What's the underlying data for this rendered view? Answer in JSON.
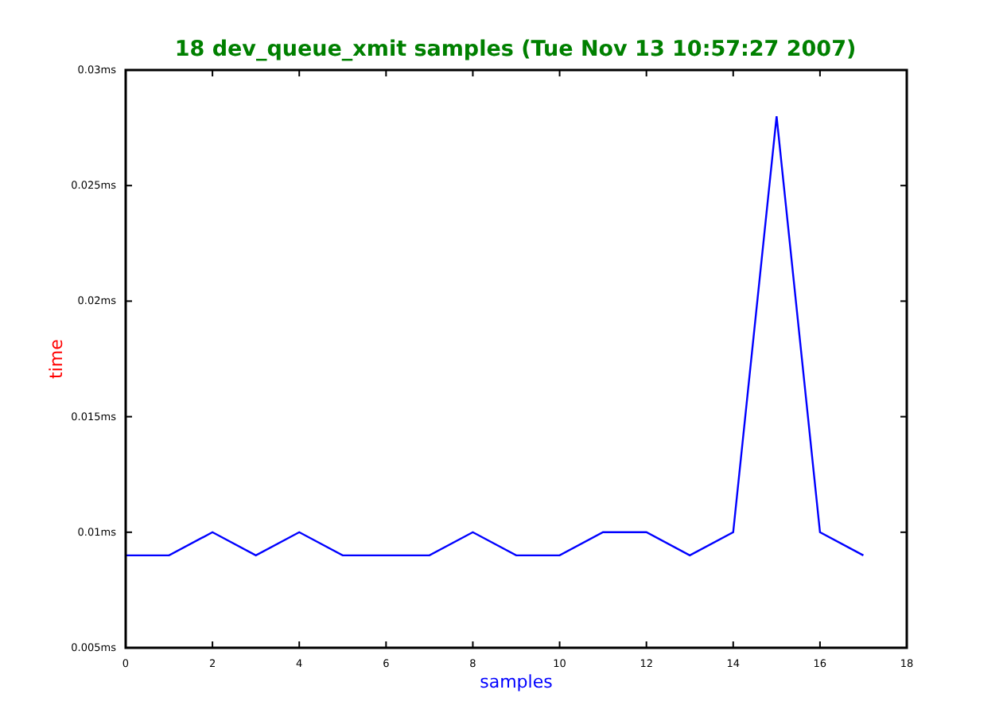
{
  "chart": {
    "chart_data": {
      "type": "line",
      "title": "18 dev_queue_xmit samples (Tue Nov 13 10:57:27 2007)",
      "xlabel": "samples",
      "ylabel": "time",
      "x": [
        0,
        1,
        2,
        3,
        4,
        5,
        6,
        7,
        8,
        9,
        10,
        11,
        12,
        13,
        14,
        15,
        16,
        17
      ],
      "series": [
        {
          "color": "#0000ff",
          "values": [
            0.009,
            0.009,
            0.01,
            0.009,
            0.01,
            0.009,
            0.009,
            0.009,
            0.01,
            0.009,
            0.009,
            0.01,
            0.01,
            0.009,
            0.01,
            0.028,
            0.01,
            0.009
          ]
        }
      ],
      "xlim": [
        0,
        18
      ],
      "ylim": [
        0.005,
        0.03
      ],
      "xticks": [
        0,
        2,
        4,
        6,
        8,
        10,
        12,
        14,
        16,
        18
      ],
      "yticks": [
        {
          "value": 0.005,
          "label": "0.005ms"
        },
        {
          "value": 0.01,
          "label": "0.01ms"
        },
        {
          "value": 0.015,
          "label": "0.015ms"
        },
        {
          "value": 0.02,
          "label": "0.02ms"
        },
        {
          "value": 0.025,
          "label": "0.025ms"
        },
        {
          "value": 0.03,
          "label": "0.03ms"
        }
      ]
    }
  }
}
